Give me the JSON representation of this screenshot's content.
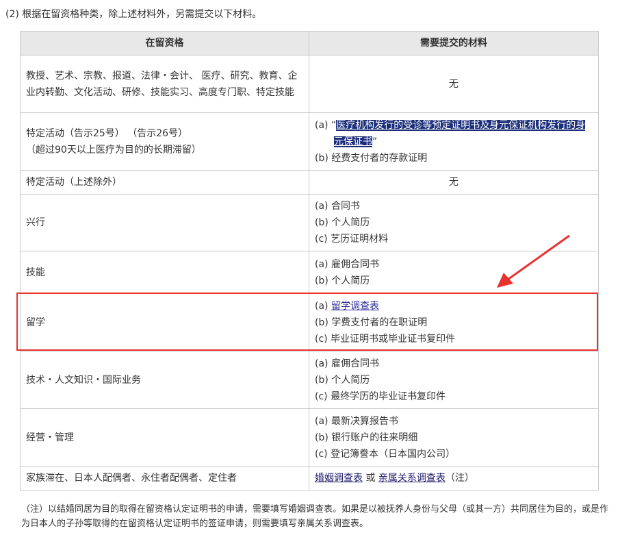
{
  "intro": "(2) 根据在留资格种类，除上述材料外，另需提交以下材料。",
  "table": {
    "headers": [
      "在留资格",
      "需要提交的材料"
    ],
    "rows": [
      {
        "status": "教授、艺术、宗教、报道、法律・会计、 医疗、研究、教育、企业内转勤、文化活动、研修、技能实习、高度专门职、特定技能",
        "materials_plain": "无"
      },
      {
        "status_l1": "特定活动（告示25号） （告示26号）",
        "status_l2": "（超过90天以上医疗为目的的长期滞留）",
        "mat_a_prefix": "(a) “",
        "mat_a_link": "医疗机构发行的受诊等预定证明书及身元保证机构发行的身元保证书",
        "mat_a_suffix": "”",
        "mat_b": "(b) 经费支付者的存款证明"
      },
      {
        "status": "特定活动（上述除外）",
        "materials_plain": "无"
      },
      {
        "status": "兴行",
        "mats": [
          "(a) 合同书",
          "(b) 个人简历",
          "(c) 艺历证明材料"
        ]
      },
      {
        "status": "技能",
        "mats": [
          "(a) 雇佣合同书",
          "(b) 个人简历"
        ]
      },
      {
        "status": "留学",
        "mat_a_prefix": "(a) ",
        "mat_a_link": "留学调查表",
        "mats": [
          "(b) 学费支付者的在职证明",
          "(c) 毕业证明书或毕业证书复印件"
        ]
      },
      {
        "status": "技术・人文知识・国际业务",
        "mats": [
          "(a) 雇佣合同书",
          "(b) 个人简历",
          "(c) 最终学历的毕业证书复印件"
        ]
      },
      {
        "status": "经营・管理",
        "mats": [
          "(a) 最新决算报告书",
          "(b) 银行账户的往来明细",
          "(c) 登记簿誊本（日本国内公司）"
        ]
      },
      {
        "status": "家族滞在、日本人配偶者、永住者配偶者、定住者",
        "link1": "婚姻调查表",
        "or_text": " 或 ",
        "link2": "亲属关系调查表",
        "note_ref": "（注）"
      }
    ]
  },
  "note": "（注）以结婚同居为目的取得在留资格认定证明书的申请，需要填写婚姻调查表。如果是以被抚养人身份与父母（或其一方）共同居住为目的，或是作为日本人的子孙等取得的在留资格认定证明书的签证申请，则需要填写亲属关系调查表。",
  "colors": {
    "highlight": "#e8322f",
    "header_bg": "#e8e8e8",
    "selection_bg": "#1b2e7a"
  }
}
